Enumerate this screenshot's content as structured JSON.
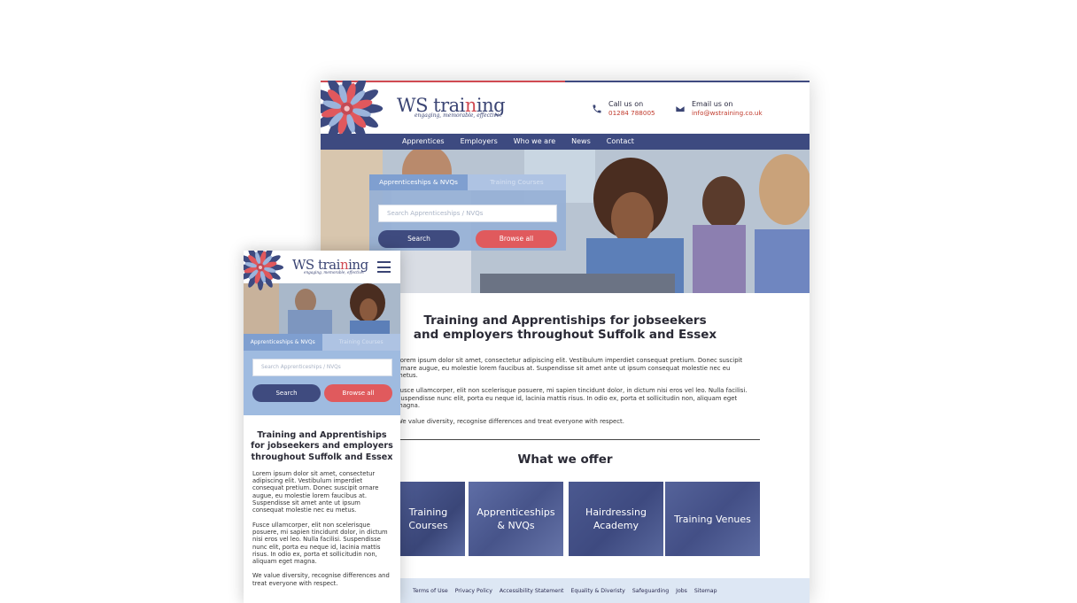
{
  "brand": {
    "logo_ws": "WS",
    "logo_training_a": "trai",
    "logo_training_i": "n",
    "logo_training_b": "ing",
    "tagline": "engaging, memorable, effective!"
  },
  "colors": {
    "navy": "#3d4a80",
    "red": "#e05a5d",
    "light_blue": "#9fbbe0",
    "footer_bg": "#dde7f4"
  },
  "desktop": {
    "contact": {
      "call_label": "Call us on",
      "call_value": "01284 788005",
      "email_label": "Email us on",
      "email_value": "info@wstraining.co.uk"
    },
    "nav": [
      "Apprentices",
      "Employers",
      "Who we are",
      "News",
      "Contact"
    ],
    "search": {
      "tab_active": "Apprenticeships & NVQs",
      "tab_inactive": "Training Courses",
      "placeholder": "Search Apprenticeships / NVQs",
      "search_button": "Search",
      "browse_button": "Browse all"
    },
    "title_line1": "Training and Apprentiships for jobseekers",
    "title_line2": "and employers throughout Suffolk and Essex",
    "paragraphs": [
      "Lorem ipsum dolor sit amet, consectetur adipiscing elit. Vestibulum imperdiet consequat pretium. Donec suscipit ornare augue, eu molestie lorem faucibus at. Suspendisse sit amet ante ut ipsum consequat molestie nec eu metus.",
      "Fusce ullamcorper, elit non scelerisque posuere, mi sapien tincidunt dolor, in dictum nisi eros vel leo. Nulla facilisi. Suspendisse nunc elit, porta eu neque id, lacinia mattis risus. In odio ex, porta et sollicitudin non, aliquam eget magna.",
      "We value diversity, recognise differences and treat everyone with respect."
    ],
    "offer_heading": "What we offer",
    "tiles": [
      "Training Courses",
      "Apprenticeships & NVQs",
      "Hairdressing Academy",
      "Training Venues"
    ],
    "footer_links": [
      "Terms of Use",
      "Privacy Policy",
      "Accessibility Statement",
      "Equality & Diveristy",
      "Safeguarding",
      "Jobs",
      "Sitemap"
    ]
  },
  "mobile": {
    "search": {
      "tab_active": "Apprenticeships & NVQs",
      "tab_inactive": "Training Courses",
      "placeholder": "Search Apprenticeships / NVQs",
      "search_button": "Search",
      "browse_button": "Browse all"
    },
    "title": "Training and Apprentiships for jobseekers and employers throughout Suffolk and Essex",
    "paragraphs": [
      "Lorem ipsum dolor sit amet, consectetur adipiscing elit. Vestibulum imperdiet consequat pretium. Donec suscipit ornare augue, eu molestie lorem faucibus at. Suspendisse sit amet ante ut ipsum consequat molestie nec eu metus.",
      "Fusce ullamcorper, elit non scelerisque posuere, mi sapien tincidunt dolor, in dictum nisi eros vel leo. Nulla facilisi. Suspendisse nunc elit, porta eu neque id, lacinia mattis risus. In odio ex, porta et sollicitudin non, aliquam eget magna.",
      "We value diversity, recognise differences and treat everyone with respect."
    ]
  }
}
